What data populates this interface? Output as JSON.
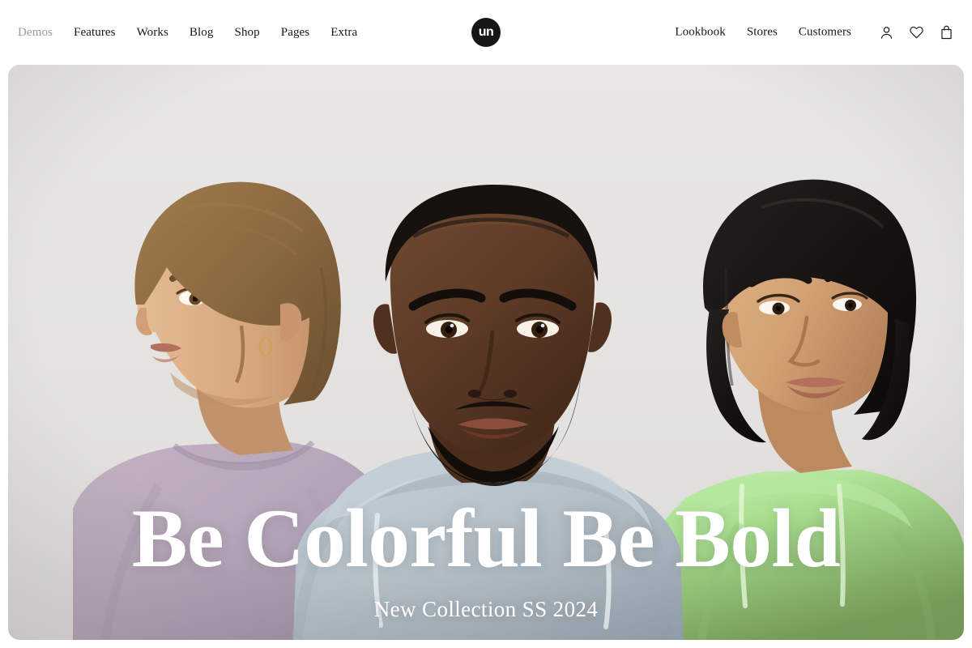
{
  "header": {
    "nav_left": [
      {
        "label": "Demos",
        "muted": true
      },
      {
        "label": "Features",
        "muted": false
      },
      {
        "label": "Works",
        "muted": false
      },
      {
        "label": "Blog",
        "muted": false
      },
      {
        "label": "Shop",
        "muted": false
      },
      {
        "label": "Pages",
        "muted": false
      },
      {
        "label": "Extra",
        "muted": false
      }
    ],
    "nav_right": [
      {
        "label": "Lookbook"
      },
      {
        "label": "Stores"
      },
      {
        "label": "Customers"
      }
    ],
    "icons": [
      {
        "name": "account-icon",
        "label": "Account"
      },
      {
        "name": "wishlist-heart-icon",
        "label": "Wishlist"
      },
      {
        "name": "shopping-bag-icon",
        "label": "Cart"
      }
    ],
    "logo": {
      "text": "un",
      "background": "#161616",
      "color": "#ffffff"
    }
  },
  "hero": {
    "title": "Be Colorful Be Bold",
    "subtitle": "New Collection SS 2024",
    "text_color": "#ffffff",
    "background": "#e4e3e1",
    "models": [
      {
        "position": "left",
        "garment": "crewneck sweatshirt",
        "garment_color": "#b8a8bb",
        "hair_color": "#8a6a43",
        "skin_color": "#d7a87f"
      },
      {
        "position": "center",
        "garment": "hoodie",
        "garment_color": "#b9c4cc",
        "hair_color": "#171210",
        "skin_color": "#5a3a28"
      },
      {
        "position": "right",
        "garment": "hoodie",
        "garment_color": "#b8e6a4",
        "hair_color": "#15120f",
        "skin_color": "#d8ab7e"
      }
    ]
  }
}
